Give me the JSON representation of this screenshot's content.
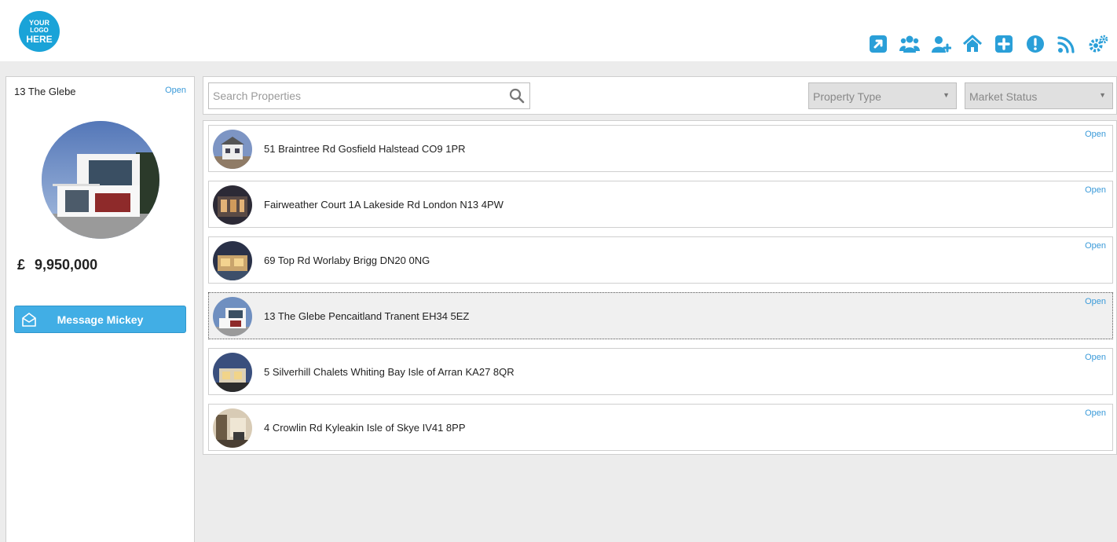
{
  "header": {
    "logo": {
      "line1": "YOUR",
      "line2": "LOGO",
      "line3": "HERE"
    },
    "accent_color": "#1aa3d8",
    "toolbar_icons": [
      "external-link-icon",
      "users-icon",
      "add-user-icon",
      "home-icon",
      "add-icon",
      "alert-icon",
      "rss-icon",
      "settings-icon"
    ]
  },
  "selected_property": {
    "title": "13 The Glebe",
    "open_label": "Open",
    "currency": "£",
    "price": "9,950,000",
    "message_button_label": "Message Mickey"
  },
  "search": {
    "placeholder": "Search Properties",
    "value": ""
  },
  "filters": {
    "property_type": "Property Type",
    "market_status": "Market Status"
  },
  "properties": [
    {
      "address": "51 Braintree Rd Gosfield Halstead CO9 1PR",
      "open_label": "Open",
      "selected": false
    },
    {
      "address": "Fairweather Court 1A Lakeside Rd London N13 4PW",
      "open_label": "Open",
      "selected": false
    },
    {
      "address": "69 Top Rd Worlaby Brigg DN20 0NG",
      "open_label": "Open",
      "selected": false
    },
    {
      "address": "13 The Glebe Pencaitland Tranent EH34 5EZ",
      "open_label": "Open",
      "selected": true
    },
    {
      "address": "5 Silverhill Chalets Whiting Bay Isle of Arran KA27 8QR",
      "open_label": "Open",
      "selected": false
    },
    {
      "address": "4 Crowlin Rd Kyleakin Isle of Skye IV41 8PP",
      "open_label": "Open",
      "selected": false
    }
  ]
}
